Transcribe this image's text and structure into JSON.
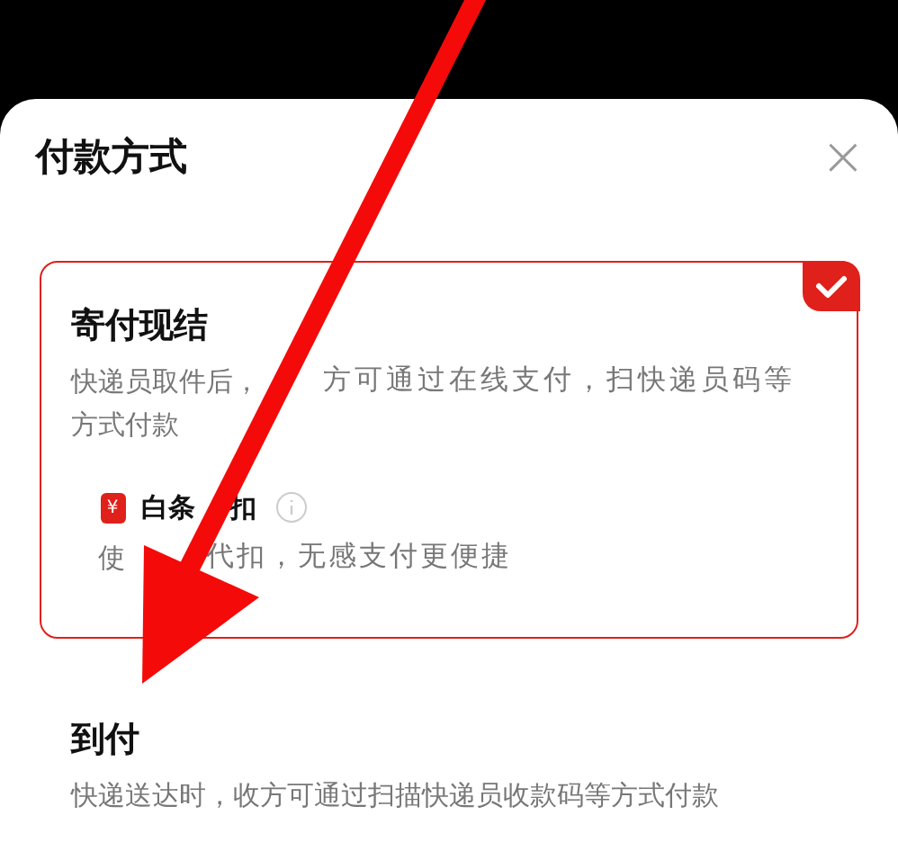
{
  "sheet": {
    "title": "付款方式",
    "close": "×"
  },
  "options": [
    {
      "title": "寄付现结",
      "description_lines": [
        [
          "快递员取件后，",
          "方可通过在线支付，扫快递员码等"
        ],
        [
          "方式付款"
        ]
      ],
      "selected": true,
      "sub_option": {
        "icon": "¥",
        "label_parts": [
          "白条",
          "扣"
        ],
        "description_parts": [
          "使",
          "代扣，无感支付更便捷"
        ]
      }
    },
    {
      "title": "到付",
      "description_lines": [
        [
          "快递送达时，收方可通过扫描快递员收款码等方式付款"
        ]
      ],
      "selected": false
    }
  ]
}
